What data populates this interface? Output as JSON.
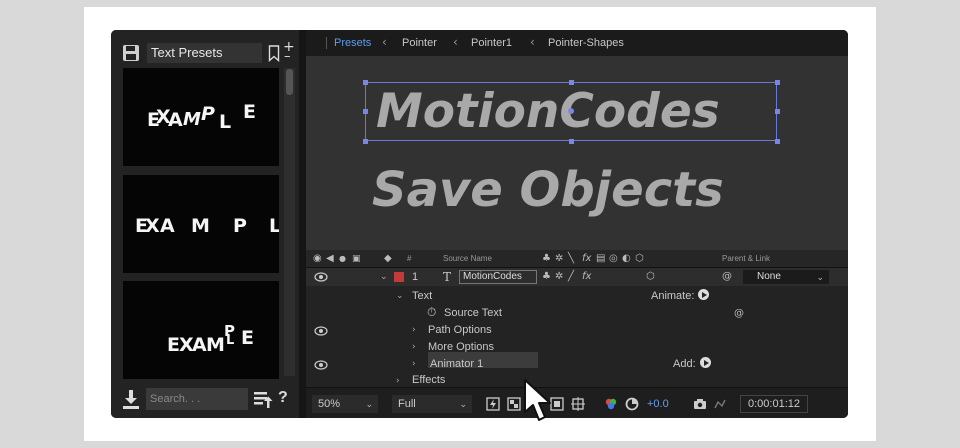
{
  "left_panel": {
    "title": "Text Presets",
    "presets": [
      {
        "text": "EXAMPLE",
        "style": "jumbled"
      },
      {
        "text": "EXAMPLE",
        "style": "spaced"
      },
      {
        "text": "EXAMPLE",
        "style": "bounce"
      }
    ],
    "search_placeholder": "Search. . ."
  },
  "breadcrumbs": [
    "Presets",
    "Pointer",
    "Pointer1",
    "Pointer-Shapes"
  ],
  "composition": {
    "line1": "MotionCodes",
    "line2": "Save Objects"
  },
  "timeline": {
    "col_hash": "#",
    "col_source": "Source Name",
    "col_parent": "Parent & Link",
    "layer": {
      "index": "1",
      "type_icon": "T",
      "name": "MotionCodes",
      "parent": "None"
    },
    "props": {
      "text": "Text",
      "animate": "Animate:",
      "source_text": "Source Text",
      "path_options": "Path Options",
      "more_options": "More Options",
      "animator": "Animator 1",
      "add": "Add:",
      "effects": "Effects"
    }
  },
  "bottom_bar": {
    "zoom": "50%",
    "resolution": "Full",
    "exposure": "+0.0",
    "timecode": "0:00:01:12"
  },
  "colors": {
    "accent": "#5b9ef0",
    "label_red": "#c23b3b",
    "bbox": "#6b79d6"
  }
}
